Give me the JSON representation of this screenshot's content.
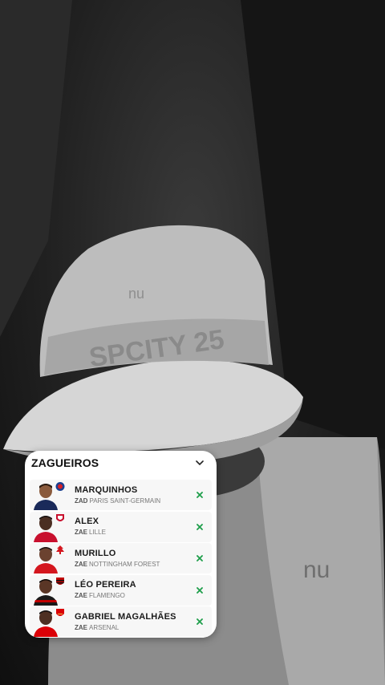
{
  "colors": {
    "accent_green": "#1e9e4a",
    "panel_bg": "#ffffff",
    "row_bg": "#f7f7f7"
  },
  "panel": {
    "title": "ZAGUEIROS",
    "toggle_icon": "chevron-down-icon",
    "players": [
      {
        "name": "MARQUINHOS",
        "position": "ZAD",
        "club": "PARIS SAINT-GERMAIN",
        "crest_color": "#1a3f8f",
        "shirt_color": "#1a2a5a",
        "action_icon": "close-icon"
      },
      {
        "name": "ALEX",
        "position": "ZAE",
        "club": "LILLE",
        "crest_color": "#c8102e",
        "shirt_color": "#c8102e",
        "action_icon": "close-icon"
      },
      {
        "name": "MURILLO",
        "position": "ZAE",
        "club": "NOTTINGHAM FOREST",
        "crest_color": "#d4161e",
        "shirt_color": "#d4161e",
        "action_icon": "close-icon"
      },
      {
        "name": "LÉO PEREIRA",
        "position": "ZAE",
        "club": "FLAMENGO",
        "crest_color": "#c00000",
        "shirt_color": "#1a1a1a",
        "action_icon": "close-icon"
      },
      {
        "name": "GABRIEL MAGALHÃES",
        "position": "ZAE",
        "club": "ARSENAL",
        "crest_color": "#db0007",
        "shirt_color": "#db0007",
        "action_icon": "close-icon"
      }
    ]
  }
}
